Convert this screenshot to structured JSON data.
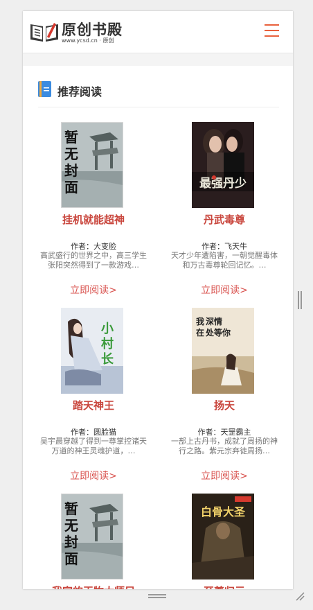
{
  "header": {
    "logo_title": "原创书殿",
    "logo_sub": "www.ycsd.cn · 原创"
  },
  "section": {
    "title": "推荐阅读"
  },
  "books": [
    {
      "title": "挂机就能超神",
      "author": "作者：大变脸",
      "desc": "高武盛行的世界之中，高三学生张阳突然得到了一款游戏…",
      "read": "立即阅读>",
      "cover": "暂无封面"
    },
    {
      "title": "丹武毒尊",
      "author": "作者：飞天牛",
      "desc": "天才少年遭陷害，一朝觉醒毒体和万古毒尊轮回记忆。…",
      "read": "立即阅读>",
      "cover": "最强丹少"
    },
    {
      "title": "踏天神王",
      "author": "作者：圆脸猫",
      "desc": "吴宇晨穿越了得到一尊掌控诸天万道的神王灵魂护道，…",
      "read": "立即阅读>",
      "cover": "小村长"
    },
    {
      "title": "扬天",
      "author": "作者：天罡霸主",
      "desc": "一部上古丹书，成就了周扬的神行之路。紫元宗弃徒周扬…",
      "read": "立即阅读>",
      "cover": "我在深情处等你"
    },
    {
      "title": "我家的王牧大师兄",
      "author": "",
      "desc": "",
      "read": "",
      "cover": "暂无封面"
    },
    {
      "title": "至尊归元",
      "author": "",
      "desc": "",
      "read": "",
      "cover": "白骨大圣"
    }
  ],
  "colors": {
    "accent": "#c9463d",
    "menu": "#e8603c"
  }
}
